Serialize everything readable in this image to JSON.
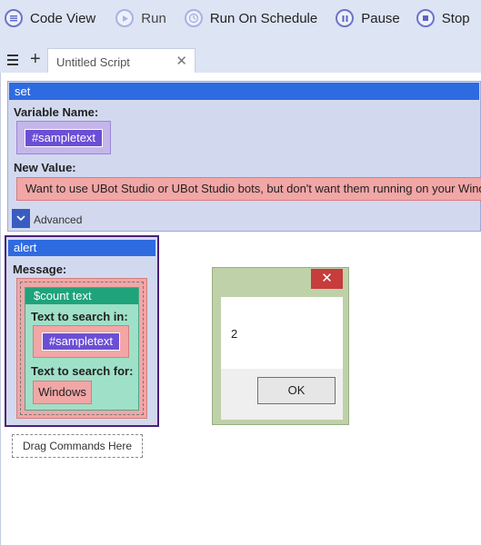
{
  "toolbar": {
    "code_view": "Code View",
    "run": "Run",
    "run_on_schedule": "Run On Schedule",
    "pause": "Pause",
    "stop": "Stop"
  },
  "tabs": {
    "active_title": "Untitled Script",
    "close_glyph": "✕",
    "add_glyph": "+"
  },
  "set_block": {
    "title": "set",
    "variable_label": "Variable Name:",
    "variable_value": "#sampletext",
    "new_value_label": "New Value:",
    "new_value": "Want to use UBot Studio or UBot Studio bots, but don't want them running on your Windows",
    "advanced_label": "Advanced"
  },
  "alert_block": {
    "title": "alert",
    "message_label": "Message:",
    "count_block": {
      "title": "$count text",
      "search_in_label": "Text to search in:",
      "search_in_value": "#sampletext",
      "search_for_label": "Text to search for:",
      "search_for_value": "Windows"
    }
  },
  "drag_hint": "Drag Commands Here",
  "dialog": {
    "close_glyph": "✕",
    "message": "2",
    "ok_label": "OK"
  },
  "colors": {
    "toolbar_bg": "#dde4f4",
    "block_header": "#2f6be0",
    "variable_chip": "#6a4fd6",
    "value_field": "#f2a6a6",
    "count_header": "#1fa37a",
    "dialog_frame": "#bfd1a8",
    "dialog_close": "#c73c3c"
  }
}
